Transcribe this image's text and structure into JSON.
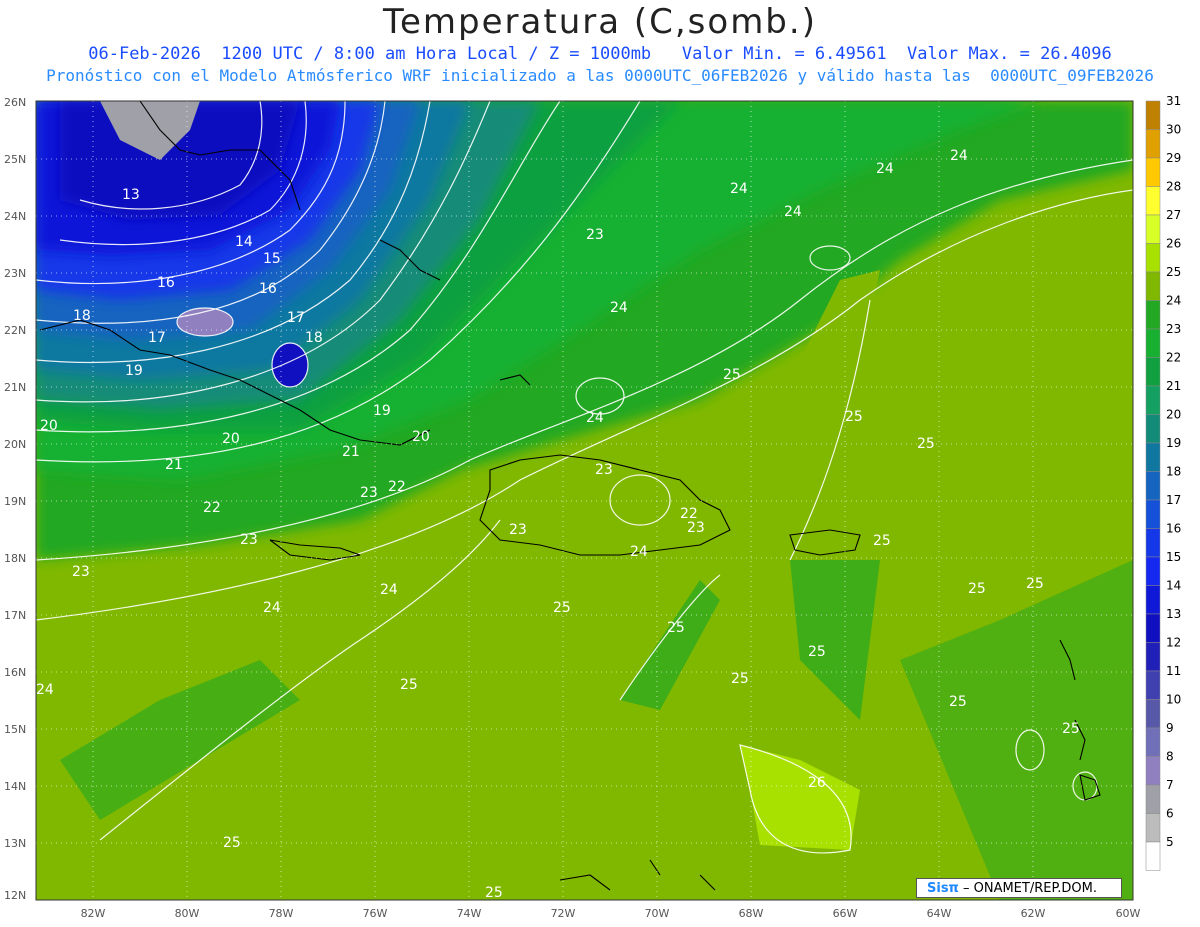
{
  "header": {
    "title": "Temperatura (C,somb.)",
    "line1": "06-Feb-2026  1200 UTC / 8:00 am Hora Local / Z = 1000mb   Valor Min. = 6.49561  Valor Max. = 26.4096",
    "line2": "Pronóstico con el Modelo Atmósferico WRF inicializado a las 0000UTC_06FEB2026 y válido hasta las  0000UTC_09FEB2026"
  },
  "axes": {
    "lat_labels": [
      "26N",
      "25N",
      "24N",
      "23N",
      "22N",
      "21N",
      "20N",
      "19N",
      "18N",
      "17N",
      "16N",
      "15N",
      "14N",
      "13N",
      "12N"
    ],
    "lon_labels": [
      "82W",
      "80W",
      "78W",
      "76W",
      "74W",
      "72W",
      "70W",
      "68W",
      "66W",
      "64W",
      "62W",
      "60W"
    ]
  },
  "legend": {
    "levels": [
      "31",
      "30",
      "29",
      "28",
      "27",
      "26",
      "25",
      "24",
      "23",
      "22",
      "21",
      "20",
      "19",
      "18",
      "17",
      "16",
      "15",
      "14",
      "13",
      "12",
      "11",
      "10",
      "9",
      "8",
      "7",
      "6",
      "5"
    ],
    "colors": [
      "#c08000",
      "#e0a000",
      "#ffc800",
      "#ffff30",
      "#d8ff28",
      "#a8e000",
      "#80b800",
      "#22a822",
      "#18b030",
      "#10a040",
      "#14a060",
      "#128c78",
      "#1078a0",
      "#1464c0",
      "#1450d8",
      "#1438e8",
      "#1428f0",
      "#1018d8",
      "#1010c0",
      "#2020b8",
      "#4040b0",
      "#5858a8",
      "#7070b8",
      "#9080c0",
      "#a0a0a8",
      "#bcbcbc",
      "#ffffff"
    ]
  },
  "contour_labels": [
    "13",
    "14",
    "15",
    "16",
    "17",
    "18",
    "19",
    "20",
    "21",
    "22",
    "23",
    "24",
    "25",
    "26"
  ],
  "credit": {
    "logo": "Sisπ",
    "text": "– ONAMET/REP.DOM."
  }
}
